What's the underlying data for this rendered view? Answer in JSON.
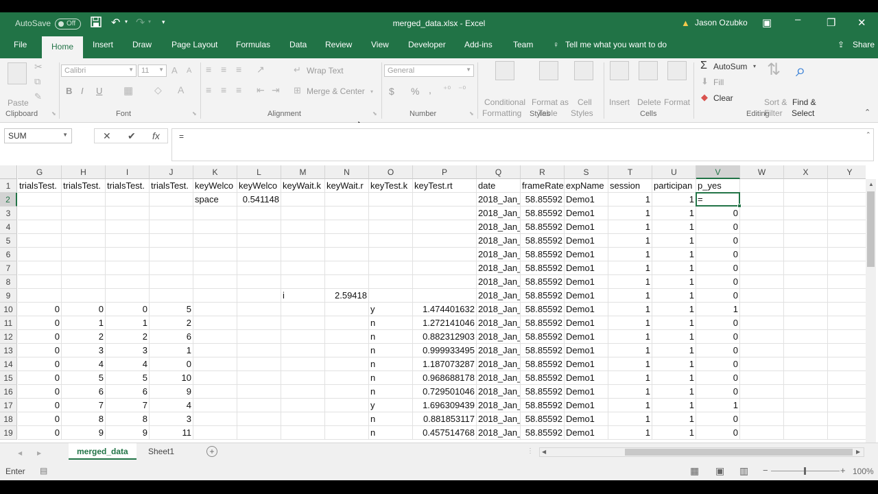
{
  "window": {
    "title": "merged_data.xlsx  -  Excel",
    "autosave_label": "AutoSave",
    "autosave_state": "Off",
    "user_name": "Jason Ozubko"
  },
  "tabs": [
    "File",
    "Home",
    "Insert",
    "Draw",
    "Page Layout",
    "Formulas",
    "Data",
    "Review",
    "View",
    "Developer",
    "Add-ins",
    "Team"
  ],
  "active_tab": "Home",
  "tell_me": "Tell me what you want to do",
  "share": "Share",
  "ribbon": {
    "clipboard": {
      "label": "Clipboard",
      "paste": "Paste"
    },
    "font": {
      "label": "Font",
      "name": "Calibri",
      "size": "11",
      "bold": "B",
      "italic": "I",
      "underline": "U"
    },
    "alignment": {
      "label": "Alignment",
      "wrap": "Wrap Text",
      "merge": "Merge & Center"
    },
    "number": {
      "label": "Number",
      "format": "General",
      "currency": "$",
      "percent": "%",
      "comma": ","
    },
    "styles": {
      "label": "Styles",
      "cond1": "Conditional",
      "cond2": "Formatting",
      "fmt1": "Format as",
      "fmt2": "Table",
      "cell1": "Cell",
      "cell2": "Styles"
    },
    "cells": {
      "label": "Cells",
      "insert": "Insert",
      "delete": "Delete",
      "format": "Format"
    },
    "editing": {
      "label": "Editing",
      "autosum": "AutoSum",
      "fill": "Fill",
      "clear": "Clear",
      "sort1": "Sort &",
      "sort2": "Filter",
      "find1": "Find &",
      "find2": "Select"
    }
  },
  "formula_bar": {
    "name_box": "SUM",
    "cancel": "✕",
    "enter": "✔",
    "fx": "fx",
    "content": "="
  },
  "columns": [
    "G",
    "H",
    "I",
    "J",
    "K",
    "L",
    "M",
    "N",
    "O",
    "P",
    "Q",
    "R",
    "S",
    "T",
    "U",
    "V",
    "W",
    "X",
    "Y"
  ],
  "selected_column": "V",
  "selected_row": "2",
  "rows": [
    {
      "num": "1",
      "cells": [
        "trialsTest.",
        "trialsTest.",
        "trialsTest.",
        "trialsTest.",
        "keyWelco",
        "keyWelco",
        "keyWait.k",
        "keyWait.r",
        "keyTest.k",
        "keyTest.rt",
        "date",
        "frameRate",
        "expName",
        "session",
        "participan",
        "p_yes",
        "",
        "",
        ""
      ]
    },
    {
      "num": "2",
      "cells": [
        "",
        "",
        "",
        "",
        "space",
        "0.541148",
        "",
        "",
        "",
        "",
        "2018_Jan_",
        "58.85592",
        "Demo1",
        "1",
        "1",
        "=",
        "",
        "",
        ""
      ]
    },
    {
      "num": "3",
      "cells": [
        "",
        "",
        "",
        "",
        "",
        "",
        "",
        "",
        "",
        "",
        "2018_Jan_",
        "58.85592",
        "Demo1",
        "1",
        "1",
        "0",
        "",
        "",
        ""
      ]
    },
    {
      "num": "4",
      "cells": [
        "",
        "",
        "",
        "",
        "",
        "",
        "",
        "",
        "",
        "",
        "2018_Jan_",
        "58.85592",
        "Demo1",
        "1",
        "1",
        "0",
        "",
        "",
        ""
      ]
    },
    {
      "num": "5",
      "cells": [
        "",
        "",
        "",
        "",
        "",
        "",
        "",
        "",
        "",
        "",
        "2018_Jan_",
        "58.85592",
        "Demo1",
        "1",
        "1",
        "0",
        "",
        "",
        ""
      ]
    },
    {
      "num": "6",
      "cells": [
        "",
        "",
        "",
        "",
        "",
        "",
        "",
        "",
        "",
        "",
        "2018_Jan_",
        "58.85592",
        "Demo1",
        "1",
        "1",
        "0",
        "",
        "",
        ""
      ]
    },
    {
      "num": "7",
      "cells": [
        "",
        "",
        "",
        "",
        "",
        "",
        "",
        "",
        "",
        "",
        "2018_Jan_",
        "58.85592",
        "Demo1",
        "1",
        "1",
        "0",
        "",
        "",
        ""
      ]
    },
    {
      "num": "8",
      "cells": [
        "",
        "",
        "",
        "",
        "",
        "",
        "",
        "",
        "",
        "",
        "2018_Jan_",
        "58.85592",
        "Demo1",
        "1",
        "1",
        "0",
        "",
        "",
        ""
      ]
    },
    {
      "num": "9",
      "cells": [
        "",
        "",
        "",
        "",
        "",
        "",
        "i",
        "2.59418",
        "",
        "",
        "2018_Jan_",
        "58.85592",
        "Demo1",
        "1",
        "1",
        "0",
        "",
        "",
        ""
      ]
    },
    {
      "num": "10",
      "cells": [
        "0",
        "0",
        "0",
        "5",
        "",
        "",
        "",
        "",
        "y",
        "1.474401632",
        "2018_Jan_",
        "58.85592",
        "Demo1",
        "1",
        "1",
        "1",
        "",
        "",
        ""
      ]
    },
    {
      "num": "11",
      "cells": [
        "0",
        "1",
        "1",
        "2",
        "",
        "",
        "",
        "",
        "n",
        "1.272141046",
        "2018_Jan_",
        "58.85592",
        "Demo1",
        "1",
        "1",
        "0",
        "",
        "",
        ""
      ]
    },
    {
      "num": "12",
      "cells": [
        "0",
        "2",
        "2",
        "6",
        "",
        "",
        "",
        "",
        "n",
        "0.882312903",
        "2018_Jan_",
        "58.85592",
        "Demo1",
        "1",
        "1",
        "0",
        "",
        "",
        ""
      ]
    },
    {
      "num": "13",
      "cells": [
        "0",
        "3",
        "3",
        "1",
        "",
        "",
        "",
        "",
        "n",
        "0.999933495",
        "2018_Jan_",
        "58.85592",
        "Demo1",
        "1",
        "1",
        "0",
        "",
        "",
        ""
      ]
    },
    {
      "num": "14",
      "cells": [
        "0",
        "4",
        "4",
        "0",
        "",
        "",
        "",
        "",
        "n",
        "1.187073287",
        "2018_Jan_",
        "58.85592",
        "Demo1",
        "1",
        "1",
        "0",
        "",
        "",
        ""
      ]
    },
    {
      "num": "15",
      "cells": [
        "0",
        "5",
        "5",
        "10",
        "",
        "",
        "",
        "",
        "n",
        "0.968688178",
        "2018_Jan_",
        "58.85592",
        "Demo1",
        "1",
        "1",
        "0",
        "",
        "",
        ""
      ]
    },
    {
      "num": "16",
      "cells": [
        "0",
        "6",
        "6",
        "9",
        "",
        "",
        "",
        "",
        "n",
        "0.729501046",
        "2018_Jan_",
        "58.85592",
        "Demo1",
        "1",
        "1",
        "0",
        "",
        "",
        ""
      ]
    },
    {
      "num": "17",
      "cells": [
        "0",
        "7",
        "7",
        "4",
        "",
        "",
        "",
        "",
        "y",
        "1.696309439",
        "2018_Jan_",
        "58.85592",
        "Demo1",
        "1",
        "1",
        "1",
        "",
        "",
        ""
      ]
    },
    {
      "num": "18",
      "cells": [
        "0",
        "8",
        "8",
        "3",
        "",
        "",
        "",
        "",
        "n",
        "0.881853117",
        "2018_Jan_",
        "58.85592",
        "Demo1",
        "1",
        "1",
        "0",
        "",
        "",
        ""
      ]
    },
    {
      "num": "19",
      "cells": [
        "0",
        "9",
        "9",
        "11",
        "",
        "",
        "",
        "",
        "n",
        "0.457514768",
        "2018_Jan_",
        "58.85592",
        "Demo1",
        "1",
        "1",
        "0",
        "",
        "",
        ""
      ]
    }
  ],
  "sheets": [
    "merged_data",
    "Sheet1"
  ],
  "active_sheet": "merged_data",
  "status": {
    "mode": "Enter",
    "zoom": "100%"
  },
  "colors": {
    "accent": "#217346",
    "ribbon_bg": "#f3f3f3"
  }
}
